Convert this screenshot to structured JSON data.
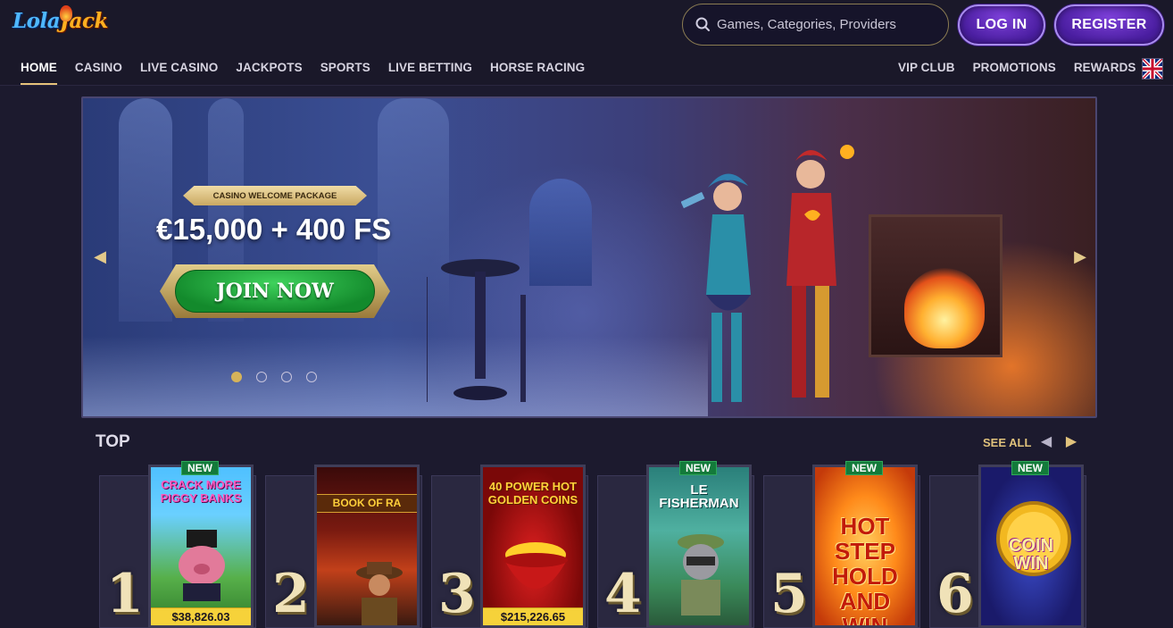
{
  "header": {
    "logo": {
      "part1": "Lola",
      "part2": "Jack"
    },
    "search": {
      "placeholder": "Games, Categories, Providers"
    },
    "login_label": "LOG IN",
    "register_label": "REGISTER",
    "language_flag": "uk-flag-icon"
  },
  "nav": {
    "left": [
      "HOME",
      "CASINO",
      "LIVE CASINO",
      "JACKPOTS",
      "SPORTS",
      "LIVE BETTING",
      "HORSE RACING"
    ],
    "right": [
      "VIP CLUB",
      "PROMOTIONS",
      "REWARDS"
    ],
    "active": "HOME"
  },
  "hero": {
    "badge": "CASINO WELCOME PACKAGE",
    "amount": "€15,000 + 400 FS",
    "cta": "JOIN NOW",
    "slides": 4,
    "active_slide": 1
  },
  "top": {
    "title": "TOP",
    "see_all": "SEE ALL",
    "games": [
      {
        "rank": "1",
        "title": "CRACK MORE PIGGY BANKS",
        "new": "NEW",
        "jackpot": "$38,826.03"
      },
      {
        "rank": "2",
        "title": "BOOK OF RA",
        "new": "",
        "jackpot": ""
      },
      {
        "rank": "3",
        "title": "40 POWER HOT GOLDEN COINS",
        "new": "",
        "jackpot": "$215,226.65"
      },
      {
        "rank": "4",
        "title": "LE FISHERMAN",
        "new": "NEW",
        "jackpot": ""
      },
      {
        "rank": "5",
        "title": "HOT STEP HOLD AND WIN",
        "new": "NEW",
        "jackpot": ""
      },
      {
        "rank": "6",
        "title": "COIN WIN",
        "new": "NEW",
        "jackpot": ""
      }
    ]
  },
  "colors": {
    "background": "#1c1a2e",
    "accent_gold": "#e0c27c",
    "button_purple": "#6a30c8",
    "cta_green": "#1ea33e",
    "jackpot_yellow": "#f6d23a"
  }
}
